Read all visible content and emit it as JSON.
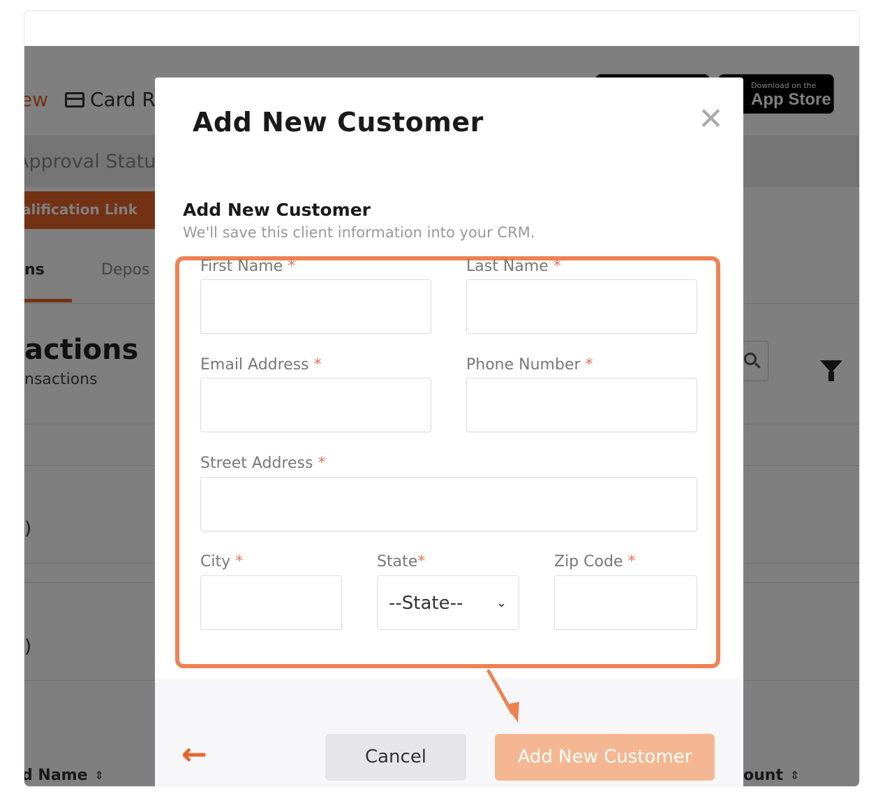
{
  "background": {
    "nav_link_1": "ew",
    "nav_link_2": "Card Re",
    "store_small": "Download on the",
    "store_big": "App Store",
    "approval": "Approval Status",
    "qualification_button": "alification Link",
    "tab_1": "ns",
    "tab_2": "Depos",
    "section_title": "actions",
    "section_sub": "nsactions",
    "paren_1": ")",
    "paren_2": ")",
    "col_left": "d Name",
    "col_right": "ount",
    "sort_icon": "⇕"
  },
  "modal": {
    "title": "Add New Customer",
    "close": "✕",
    "section_title": "Add New Customer",
    "section_subtitle": "We'll save this client information into your CRM.",
    "required_mark": "*",
    "fields": {
      "first_name": "First Name",
      "last_name": "Last Name",
      "email": "Email Address",
      "phone": "Phone Number",
      "street": "Street Address",
      "city": "City",
      "state": "State",
      "zip": "Zip Code"
    },
    "state_value": "--State--",
    "cancel_label": "Cancel",
    "submit_label": "Add New Customer",
    "back_arrow": "←"
  },
  "colors": {
    "accent": "#e8642a",
    "highlight": "#ee8253",
    "submit_disabled": "#f5b791"
  }
}
